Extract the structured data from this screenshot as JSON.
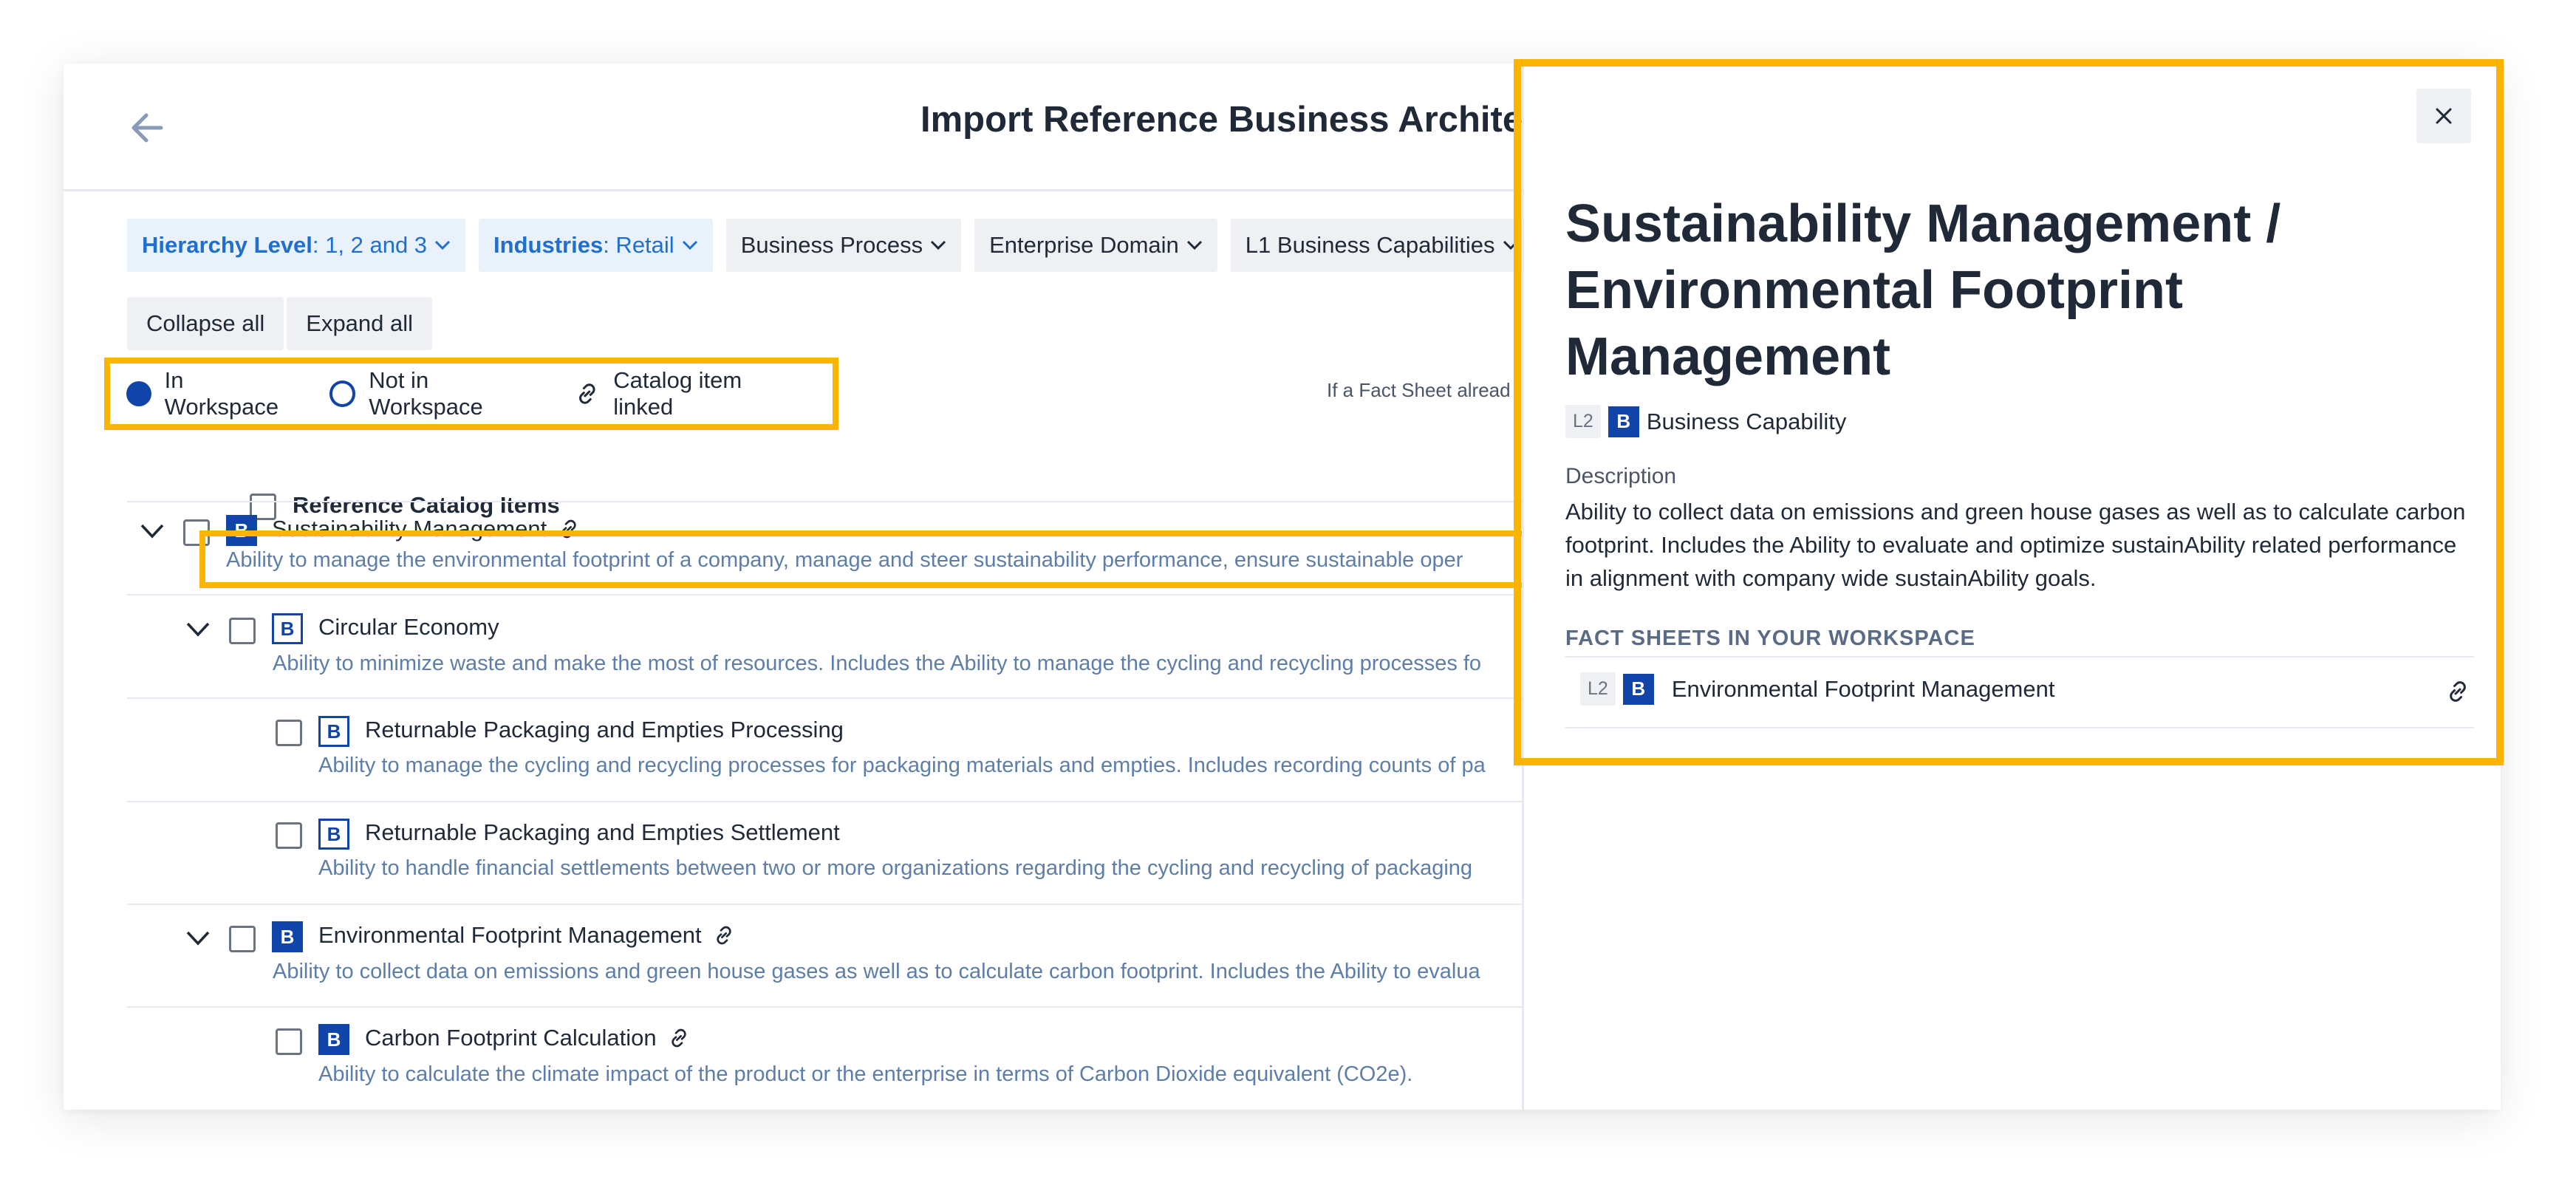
{
  "header": {
    "title": "Import Reference Business Architecture"
  },
  "filters": [
    {
      "key": "Hierarchy Level",
      "value": ": 1, 2 and 3"
    },
    {
      "key": "Industries",
      "value": ": Retail"
    },
    {
      "label": "Business Process"
    },
    {
      "label": "Enterprise Domain"
    },
    {
      "label": "L1 Business Capabilities"
    }
  ],
  "actions": {
    "collapse": "Collapse all",
    "expand": "Expand all"
  },
  "legend": {
    "in_workspace": "In Workspace",
    "not_in_workspace": "Not in Workspace",
    "linked": "Catalog item linked"
  },
  "hint": "If a Fact Sheet alread",
  "table": {
    "column_header": "Reference Catalog Items",
    "rows": [
      {
        "badge": "B",
        "name": "Sustainability Management",
        "desc": "Ability to manage the environmental footprint of a company, manage and steer sustainability performance, ensure sustainable oper"
      },
      {
        "badge": "B",
        "name": "Circular Economy",
        "desc": "Ability to minimize waste and make the most of resources. Includes the Ability to manage the cycling and recycling processes fo"
      },
      {
        "badge": "B",
        "name": "Returnable Packaging and Empties Processing",
        "desc": "Ability to manage the cycling and recycling processes for packaging materials and empties. Includes recording counts of pa"
      },
      {
        "badge": "B",
        "name": "Returnable Packaging and Empties Settlement",
        "desc": "Ability to handle financial settlements between two or more organizations regarding the cycling and recycling of packaging"
      },
      {
        "badge": "B",
        "name": "Environmental Footprint Management",
        "desc": "Ability to collect data on emissions and green house gases as well as to calculate carbon footprint. Includes the Ability to evalua"
      },
      {
        "badge": "B",
        "name": "Carbon Footprint Calculation",
        "desc": "Ability to calculate the climate impact of the product or the enterprise in terms of Carbon Dioxide equivalent (CO2e)."
      }
    ]
  },
  "panel": {
    "title": "Sustainability Management / Environmental Footprint Management",
    "level": "L2",
    "badge": "B",
    "type": "Business Capability",
    "description_label": "Description",
    "description": "Ability to collect data on emissions and green house gases as well as to calculate carbon footprint. Includes the Ability to evaluate and optimize sustainAbility related performance in alignment with company wide sustainAbility goals.",
    "section_title": "FACT SHEETS IN YOUR WORKSPACE",
    "fact_sheets": [
      {
        "level": "L2",
        "badge": "B",
        "name": "Environmental Footprint Management"
      }
    ]
  },
  "colors": {
    "accent_blue": "#1044a8",
    "highlight": "#fbb400",
    "link_blue": "#1f6fcf",
    "desc_text": "#5d7ea8"
  }
}
